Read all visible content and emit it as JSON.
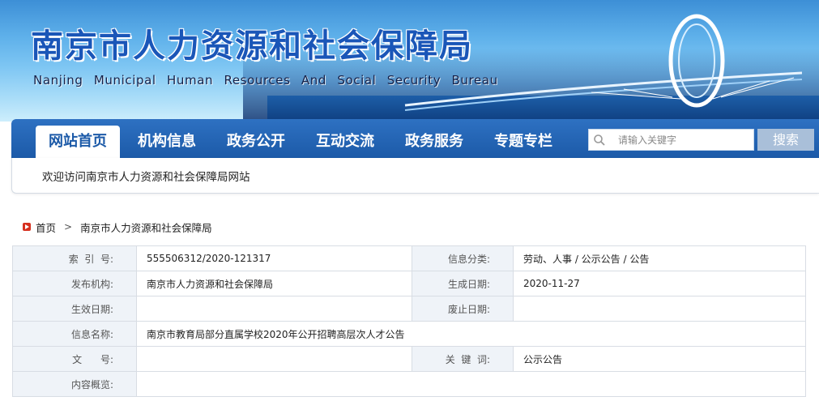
{
  "site": {
    "title_cn": "南京市人力资源和社会保障局",
    "title_en": "Nanjing Municipal Human Resources And Social Security Bureau"
  },
  "nav": {
    "items": [
      {
        "label": "网站首页",
        "active": true
      },
      {
        "label": "机构信息",
        "active": false
      },
      {
        "label": "政务公开",
        "active": false
      },
      {
        "label": "互动交流",
        "active": false
      },
      {
        "label": "政务服务",
        "active": false
      },
      {
        "label": "专题专栏",
        "active": false
      }
    ],
    "search_placeholder": "请输入关键字",
    "search_button": "搜索"
  },
  "welcome": "欢迎访问南京市人力资源和社会保障局网站",
  "breadcrumb": {
    "home": "首页",
    "separator": ">",
    "current": "南京市人力资源和社会保障局"
  },
  "info_table": {
    "index_label": "索  引  号:",
    "index_value": "555506312/2020-121317",
    "category_label": "信息分类:",
    "category_value": "劳动、人事 / 公示公告 / 公告",
    "publisher_label": "发布机构:",
    "publisher_value": "南京市人力资源和社会保障局",
    "created_label": "生成日期:",
    "created_value": "2020-11-27",
    "effective_label": "生效日期:",
    "effective_value": "",
    "expiry_label": "废止日期:",
    "expiry_value": "",
    "name_label": "信息名称:",
    "name_value": "南京市教育局部分直属学校2020年公开招聘高层次人才公告",
    "doc_no_label": "文      号:",
    "doc_no_value": "",
    "keywords_label": "关  键  词:",
    "keywords_value": "公示公告",
    "summary_label": "内容概览:",
    "summary_value": ""
  },
  "colors": {
    "nav_bg": "#1c5aa8",
    "title_blue": "#1a56b8",
    "label_bg": "#eff3f8",
    "home_icon": "#d6301f"
  }
}
